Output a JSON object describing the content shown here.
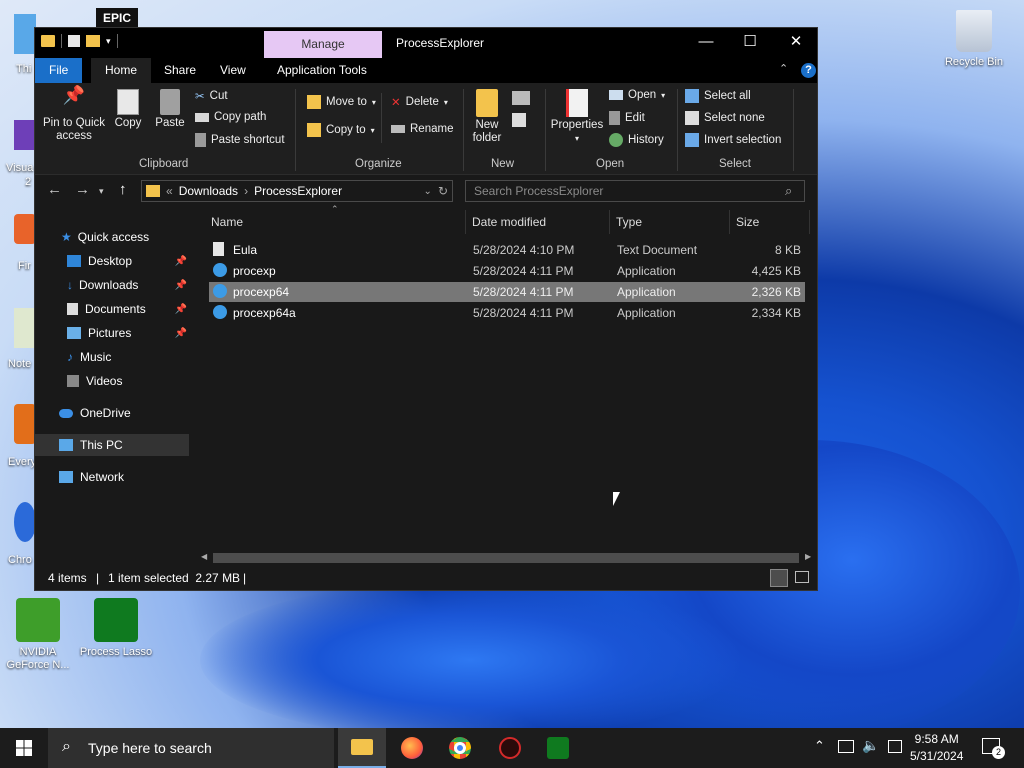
{
  "desktop": {
    "icons": [
      {
        "label": "Recycle Bin"
      },
      {
        "label": "NVIDIA\nGeForce N..."
      },
      {
        "label": "Process Lasso"
      }
    ],
    "partial_labels": [
      "Thi",
      "Visua",
      "2",
      "Fir",
      "Note",
      "Every",
      "Chro"
    ]
  },
  "window": {
    "title": "ProcessExplorer",
    "manage_tab": "Manage",
    "tabs": [
      "File",
      "Home",
      "Share",
      "View",
      "Application Tools"
    ],
    "ribbon": {
      "clipboard": {
        "group": "Clipboard",
        "pin": "Pin to Quick\naccess",
        "copy": "Copy",
        "paste": "Paste",
        "cut": "Cut",
        "copy_path": "Copy path",
        "paste_shortcut": "Paste shortcut"
      },
      "organize": {
        "group": "Organize",
        "move_to": "Move to",
        "copy_to": "Copy to",
        "delete": "Delete",
        "rename": "Rename"
      },
      "new": {
        "group": "New",
        "new_folder": "New\nfolder"
      },
      "open": {
        "group": "Open",
        "properties": "Properties",
        "open": "Open",
        "edit": "Edit",
        "history": "History"
      },
      "select": {
        "group": "Select",
        "select_all": "Select all",
        "select_none": "Select none",
        "invert": "Invert selection"
      }
    },
    "address": {
      "prefix": "«",
      "crumbs": [
        "Downloads",
        "ProcessExplorer"
      ],
      "search_placeholder": "Search ProcessExplorer"
    },
    "nav": {
      "quick_access": "Quick access",
      "items": [
        "Desktop",
        "Downloads",
        "Documents",
        "Pictures",
        "Music",
        "Videos"
      ],
      "onedrive": "OneDrive",
      "this_pc": "This PC",
      "network": "Network"
    },
    "columns": [
      "Name",
      "Date modified",
      "Type",
      "Size"
    ],
    "files": [
      {
        "name": "Eula",
        "date": "5/28/2024 4:10 PM",
        "type": "Text Document",
        "size": "8 KB"
      },
      {
        "name": "procexp",
        "date": "5/28/2024 4:11 PM",
        "type": "Application",
        "size": "4,425 KB"
      },
      {
        "name": "procexp64",
        "date": "5/28/2024 4:11 PM",
        "type": "Application",
        "size": "2,326 KB"
      },
      {
        "name": "procexp64a",
        "date": "5/28/2024 4:11 PM",
        "type": "Application",
        "size": "2,334 KB"
      }
    ],
    "status": {
      "count": "4 items",
      "selected": "1 item selected  2.27 MB"
    }
  },
  "taskbar": {
    "search_placeholder": "Type here to search",
    "time": "9:58 AM",
    "date": "5/31/2024",
    "notification_count": "2"
  }
}
